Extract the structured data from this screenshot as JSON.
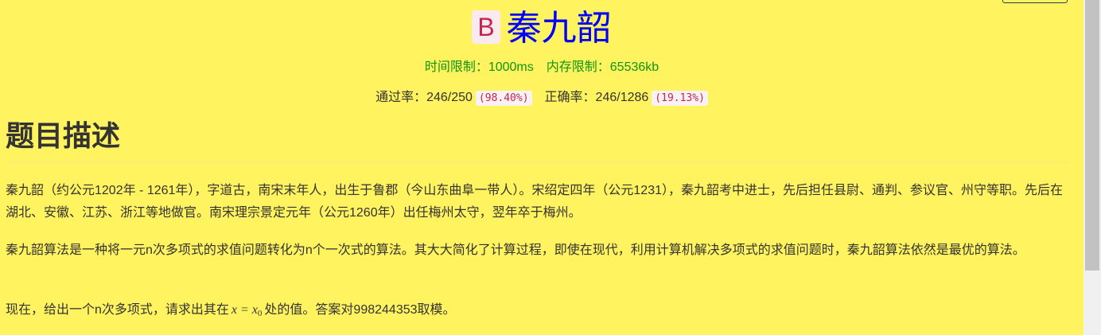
{
  "problem": {
    "badge": "B",
    "title": "秦九韶",
    "time_limit": "时间限制：1000ms",
    "memory_limit": "内存限制：65536kb",
    "pass_rate_label": "通过率：246/250",
    "pass_rate_pct": "(98.40%)",
    "accuracy_label": "正确率：246/1286",
    "accuracy_pct": "(19.13%)"
  },
  "description": {
    "heading": "题目描述",
    "paragraphs": [
      "秦九韶（约公元1202年 - 1261年），字道古，南宋末年人，出生于鲁郡（今山东曲阜一带人）。宋绍定四年（公元1231），秦九韶考中进士，先后担任县尉、通判、参议官、州守等职。先后在湖北、安徽、江苏、浙江等地做官。南宋理宗景定元年（公元1260年）出任梅州太守，翌年卒于梅州。",
      "秦九韶算法是一种将一元n次多项式的求值问题转化为n个一次式的算法。其大大简化了计算过程，即使在现代，利用计算机解决多项式的求值问题时，秦九韶算法依然是最优的算法。"
    ],
    "p3_before": "现在，给出一个n次多项式，请求出其在",
    "p3_math_var": "x",
    "p3_math_eq": " = ",
    "p3_math_x0": "x",
    "p3_math_sub": "0",
    "p3_after": "处的值。答案对998244353取模。"
  },
  "colors": {
    "background": "#fff35f",
    "title": "#0000ff",
    "limits": "#129512",
    "badge_text": "#c7254e"
  }
}
